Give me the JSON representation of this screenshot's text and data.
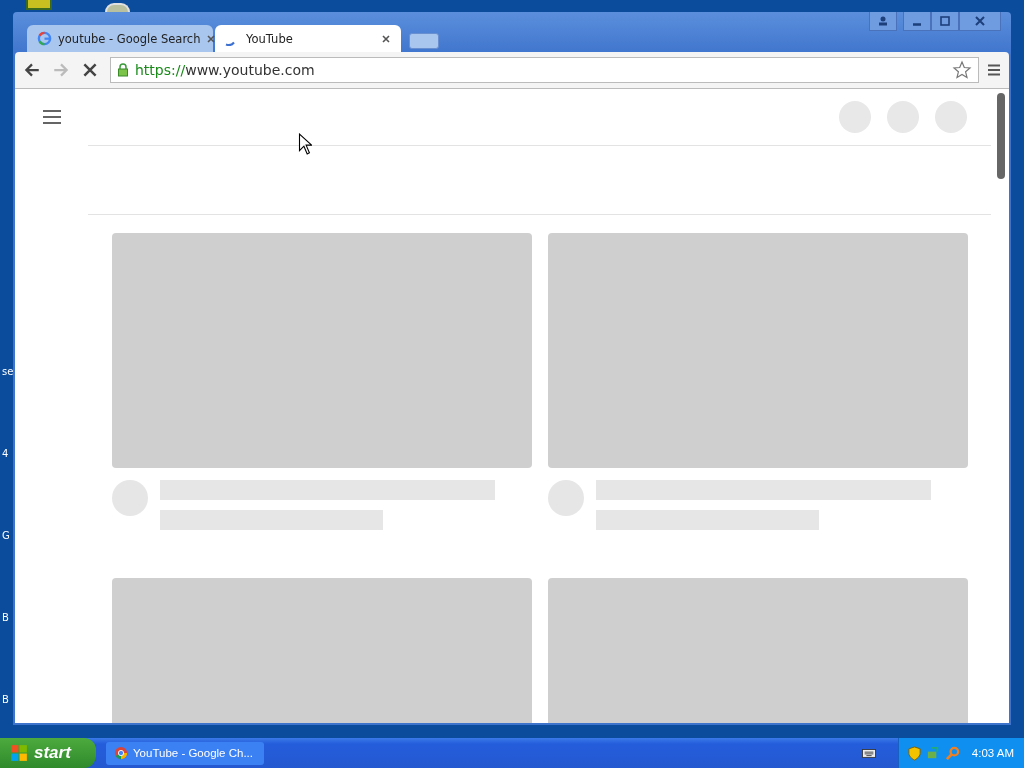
{
  "desktop": {
    "icon_labels": [
      "se",
      "4",
      "G",
      "B",
      "B"
    ]
  },
  "browser": {
    "tabs": [
      {
        "title": "youtube - Google Search",
        "selected": false,
        "loading": false
      },
      {
        "title": "YouTube",
        "selected": true,
        "loading": true
      }
    ],
    "url": {
      "scheme": "https://",
      "host": "www.youtube.com",
      "secure": true
    },
    "page_loading": true
  },
  "taskbar": {
    "start": "start",
    "tasks": [
      {
        "label": "YouTube - Google Ch...",
        "selected": false
      }
    ],
    "clock": "4:03 AM"
  }
}
